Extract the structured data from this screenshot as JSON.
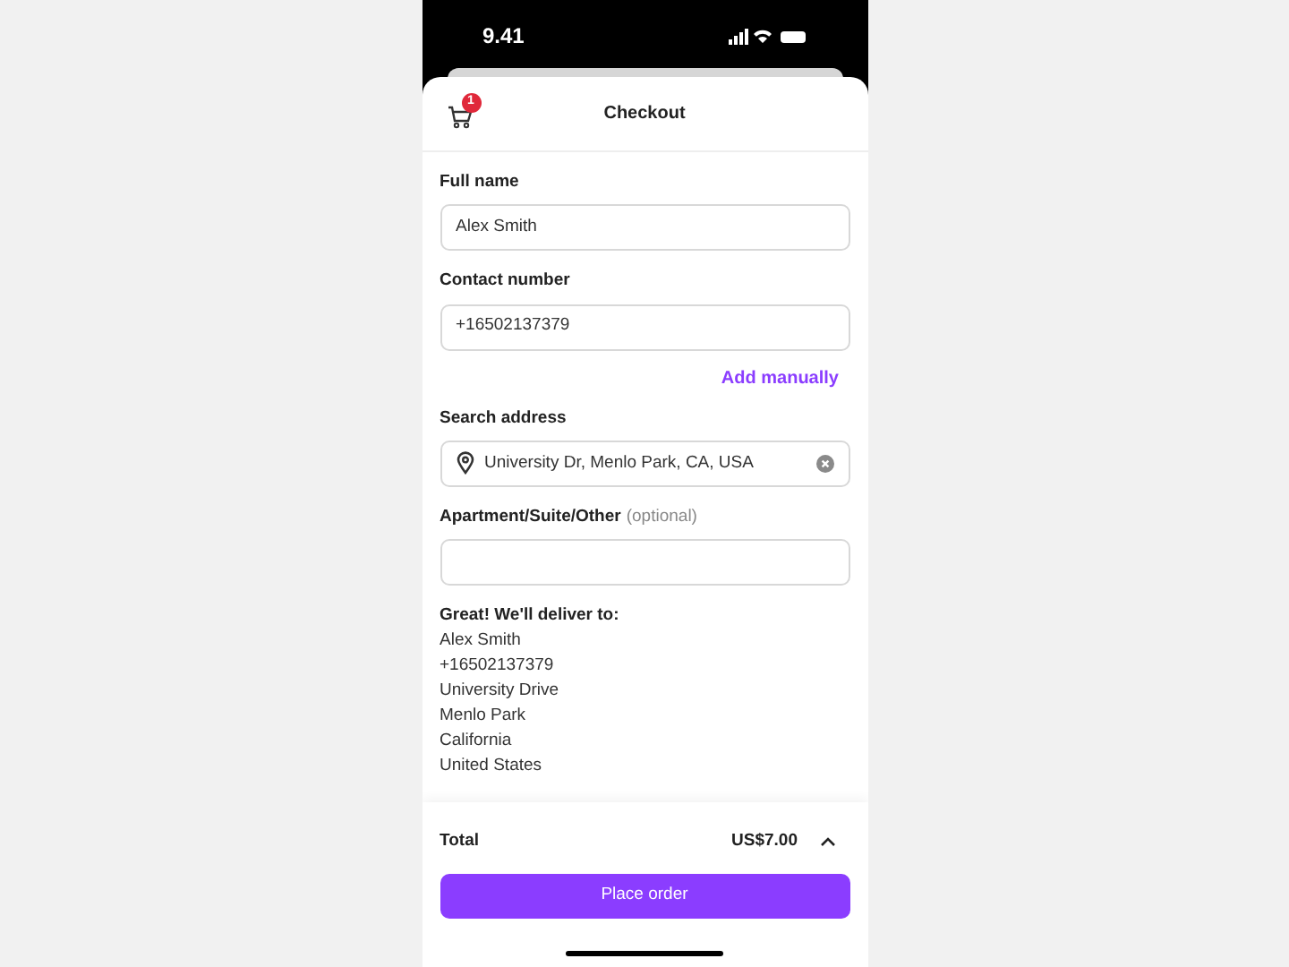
{
  "status_bar": {
    "time": "9.41"
  },
  "header": {
    "title": "Checkout",
    "cart_badge": "1"
  },
  "fields": [
    {
      "kind": "text",
      "label": "Full name",
      "value": "Alex Smith"
    },
    {
      "kind": "text",
      "label": "Contact number",
      "value": "+16502137379"
    },
    {
      "kind": "link",
      "label": "Add manually"
    },
    {
      "kind": "address",
      "label": "Search address",
      "value": "University Dr, Menlo Park, CA, USA"
    },
    {
      "kind": "text",
      "label": "Apartment/Suite/Other",
      "hint": "(optional)"
    }
  ],
  "delivery": {
    "heading": "Great! We'll deliver to:",
    "lines": [
      "Alex Smith",
      "+16502137379",
      "University Drive",
      "Menlo Park",
      "California",
      "United States"
    ]
  },
  "footer": {
    "total_label": "Total",
    "total": "US$7.00",
    "expanded": false,
    "button": "Place order"
  }
}
